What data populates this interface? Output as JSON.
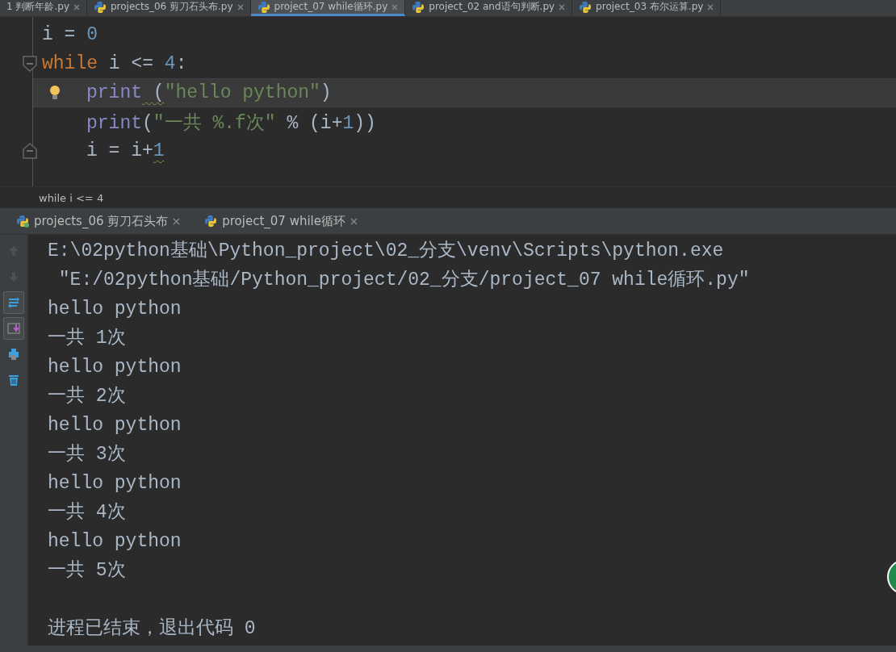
{
  "editor_tabs": [
    {
      "label": "1 判断年龄.py",
      "selected": false
    },
    {
      "label": "projects_06 剪刀石头布.py",
      "selected": false
    },
    {
      "label": "project_07 while循环.py",
      "selected": true
    },
    {
      "label": "project_02 and语句判断.py",
      "selected": false
    },
    {
      "label": "project_03 布尔运算.py",
      "selected": false
    }
  ],
  "editor": {
    "lines": [
      {
        "indented": false,
        "fold_open": false,
        "fold_close": false,
        "bulb": false,
        "current": false,
        "tokens": [
          {
            "text": "i = ",
            "kind": "plain"
          },
          {
            "text": "0",
            "kind": "number"
          }
        ]
      },
      {
        "indented": false,
        "fold_open": true,
        "fold_close": false,
        "bulb": false,
        "current": false,
        "tokens": [
          {
            "text": "while",
            "kind": "keyword"
          },
          {
            "text": " i <= ",
            "kind": "plain"
          },
          {
            "text": "4",
            "kind": "number"
          },
          {
            "text": ":",
            "kind": "plain"
          }
        ]
      },
      {
        "indented": true,
        "fold_open": false,
        "fold_close": false,
        "bulb": true,
        "current": true,
        "tokens": [
          {
            "text": "print",
            "kind": "builtin"
          },
          {
            "text": " (",
            "kind": "plain",
            "warning": true
          },
          {
            "text": "\"hello python\"",
            "kind": "string"
          },
          {
            "text": ")",
            "kind": "plain"
          }
        ]
      },
      {
        "indented": true,
        "fold_open": false,
        "fold_close": false,
        "bulb": false,
        "current": false,
        "tokens": [
          {
            "text": "print",
            "kind": "builtin"
          },
          {
            "text": "(",
            "kind": "plain"
          },
          {
            "text": "\"一共 %.f次\"",
            "kind": "string"
          },
          {
            "text": " % (i+",
            "kind": "plain"
          },
          {
            "text": "1",
            "kind": "number"
          },
          {
            "text": "))",
            "kind": "plain"
          }
        ]
      },
      {
        "indented": true,
        "fold_open": false,
        "fold_close": true,
        "bulb": false,
        "current": false,
        "tokens": [
          {
            "text": "i = i+",
            "kind": "plain"
          },
          {
            "text": "1",
            "kind": "number",
            "warning": true
          }
        ]
      }
    ],
    "breadcrumb": "while i <= 4"
  },
  "run_tabs": [
    {
      "label": "projects_06 剪刀石头布"
    },
    {
      "label": "project_07 while循环"
    }
  ],
  "toolbar": [
    {
      "disabled": true,
      "on": false
    },
    {
      "disabled": true,
      "on": false
    },
    {
      "disabled": false,
      "on": true
    },
    {
      "disabled": false,
      "on": true
    },
    {
      "disabled": false,
      "on": false
    },
    {
      "disabled": false,
      "on": false
    }
  ],
  "console": {
    "lines": [
      "E:\\02python基础\\Python_project\\02_分支\\venv\\Scripts\\python.exe",
      " \"E:/02python基础/Python_project/02_分支/project_07 while循环.py\"",
      "hello python",
      "一共 1次",
      "hello python",
      "一共 2次",
      "hello python",
      "一共 3次",
      "hello python",
      "一共 4次",
      "hello python",
      "一共 5次"
    ],
    "exit_message": "进程已结束，退出代码 0"
  }
}
